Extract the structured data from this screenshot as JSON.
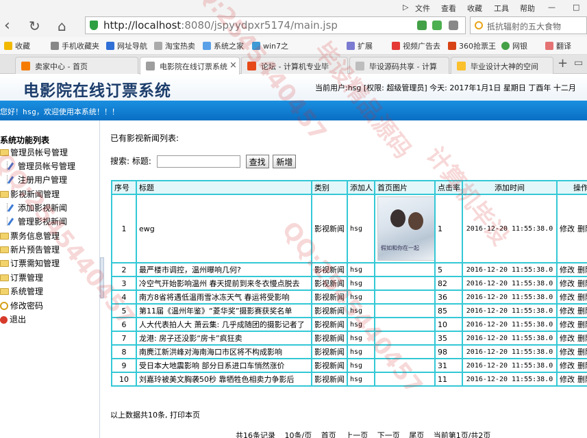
{
  "browser": {
    "menu": [
      "文件",
      "查看",
      "收藏",
      "工具",
      "帮助"
    ],
    "url_host": "http://localhost",
    "url_rest": ":8080/jspyydpxr5174/main.jsp",
    "search_text": "抵抗辐射的五大食物",
    "favorites": [
      "收藏",
      "手机收藏夹",
      "网址导航",
      "淘宝热卖",
      "系统之家",
      "win7之",
      "扩展",
      "视频广告去",
      "360抢票王",
      "网银",
      "翻译"
    ],
    "tabs": [
      "卖家中心 - 首页",
      "电影院在线订票系统",
      "论坛 - 计算机专业毕",
      "毕设源码共享 - 计算",
      "毕业设计大神的空间"
    ]
  },
  "header": {
    "title": "电影院在线订票系统",
    "userinfo": "当前用户:hsg [权限: 超级管理员] 今天:  2017年1月1日 星期日 丁酉年 十二月",
    "welcome": "您好！hsg，欢迎使用本系统！！！"
  },
  "sidebar": {
    "title": "系统功能列表",
    "items": [
      {
        "label": "管理员帐号管理",
        "type": "folder",
        "level": 0
      },
      {
        "label": "管理员帐号管理",
        "type": "leaf",
        "level": 1
      },
      {
        "label": "注册用户管理",
        "type": "leaf",
        "level": 1
      },
      {
        "label": "影视新闻管理",
        "type": "folder",
        "level": 0
      },
      {
        "label": "添加影视新闻",
        "type": "leaf",
        "level": 1
      },
      {
        "label": "管理影视新闻",
        "type": "leaf",
        "level": 1
      },
      {
        "label": "票务信息管理",
        "type": "folder",
        "level": 0
      },
      {
        "label": "新片预告管理",
        "type": "folder",
        "level": 0
      },
      {
        "label": "订票需知管理",
        "type": "folder",
        "level": 0
      },
      {
        "label": "订票管理",
        "type": "folder",
        "level": 0
      },
      {
        "label": "系统管理",
        "type": "folder",
        "level": 0
      },
      {
        "label": "修改密码",
        "type": "key",
        "level": 0
      },
      {
        "label": "退出",
        "type": "exit",
        "level": 0
      }
    ]
  },
  "main": {
    "list_title": "已有影视新闻列表:",
    "search_label": "搜索:",
    "search_field_label": "标题:",
    "search_value": "",
    "find_button": "查找",
    "add_button": "新增",
    "columns": [
      "序号",
      "标题",
      "类别",
      "添加人",
      "首页图片",
      "点击率",
      "添加时间",
      "操作"
    ],
    "poster_caption": "假如和你在一起",
    "rows": [
      {
        "no": "1",
        "title": "ewg",
        "cat": "影视新闻",
        "by": "hsg",
        "img": true,
        "hits": "1",
        "time": "2016-12-20 11:55:38.0"
      },
      {
        "no": "2",
        "title": "最严楼市调控，温州曝响几何?",
        "cat": "影视新闻",
        "by": "hsg",
        "img": false,
        "hits": "5",
        "time": "2016-12-20 11:55:38.0"
      },
      {
        "no": "3",
        "title": "冷空气开始影响温州 春天提前到来冬衣慢点脱去",
        "cat": "影视新闻",
        "by": "hsg",
        "img": false,
        "hits": "82",
        "time": "2016-12-20 11:55:38.0"
      },
      {
        "no": "4",
        "title": "南方8省将遇低温雨雪冰冻天气 春运将受影响",
        "cat": "影视新闻",
        "by": "hsg",
        "img": false,
        "hits": "36",
        "time": "2016-12-20 11:55:38.0"
      },
      {
        "no": "5",
        "title": "第11届《温州年鉴》“菱华奖”摄影赛获奖名单",
        "cat": "影视新闻",
        "by": "hsg",
        "img": false,
        "hits": "85",
        "time": "2016-12-20 11:55:38.0"
      },
      {
        "no": "6",
        "title": "人大代表拍人大  萧云集: 几乎成随团的摄影记者了",
        "cat": "影视新闻",
        "by": "hsg",
        "img": false,
        "hits": "10",
        "time": "2016-12-20 11:55:38.0"
      },
      {
        "no": "7",
        "title": "龙港: 房子还没影“房卡”疯狂卖",
        "cat": "影视新闻",
        "by": "hsg",
        "img": false,
        "hits": "35",
        "time": "2016-12-20 11:55:38.0"
      },
      {
        "no": "8",
        "title": "南麂江新洪峰对海南海口市区将不构成影响",
        "cat": "影视新闻",
        "by": "hsg",
        "img": false,
        "hits": "98",
        "time": "2016-12-20 11:55:38.0"
      },
      {
        "no": "9",
        "title": "受日本大地震影响 部分日系进口车悄然涨价",
        "cat": "影视新闻",
        "by": "hsg",
        "img": false,
        "hits": "31",
        "time": "2016-12-20 11:55:38.0"
      },
      {
        "no": "10",
        "title": "刘嘉玲被美文胸袭50秒 靠牺牲色相卖力争影后",
        "cat": "影视新闻",
        "by": "hsg",
        "img": false,
        "hits": "11",
        "time": "2016-12-20 11:55:38.0"
      }
    ],
    "edit_label": "修改",
    "delete_label": "删除",
    "footer": "以上数据共10条, 打印本页",
    "pager": {
      "total": "共16条记录",
      "per_page": "10条/页",
      "first": "首页",
      "prev": "上一页",
      "next": "下一页",
      "last": "尾页",
      "current": "当前第1页/共2页"
    }
  },
  "watermark": [
    "QQ:2545440457",
    "毕设精品源码",
    "计算机毕设"
  ]
}
